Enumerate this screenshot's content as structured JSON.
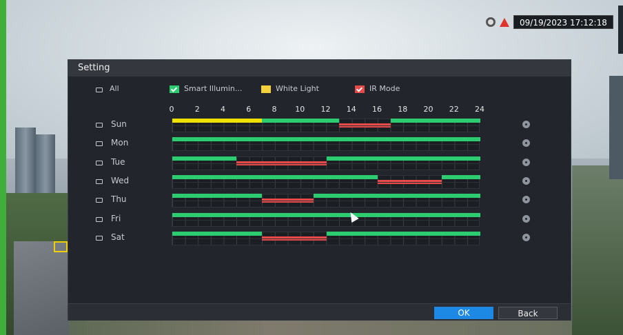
{
  "status": {
    "datetime": "09/19/2023 17:12:18"
  },
  "dialog": {
    "title": "Setting",
    "all_label": "All",
    "legend": [
      {
        "label": "Smart Illumin...",
        "color": "#2ecc71",
        "checked": true
      },
      {
        "label": "White Light",
        "color": "#f5d23a",
        "checked": false
      },
      {
        "label": "IR Mode",
        "color": "#e84a4a",
        "checked": true
      }
    ],
    "hours": [
      "0",
      "2",
      "4",
      "6",
      "8",
      "10",
      "12",
      "14",
      "16",
      "18",
      "20",
      "22",
      "24"
    ],
    "days": [
      {
        "label": "Sun",
        "bars": [
          {
            "row": 0,
            "start": 0,
            "end": 7,
            "color": "#f0e000"
          },
          {
            "row": 0,
            "start": 7,
            "end": 13,
            "color": "#2ecc71"
          },
          {
            "row": 0,
            "start": 17,
            "end": 24,
            "color": "#2ecc71"
          },
          {
            "row": 1,
            "start": 13,
            "end": 17,
            "color": "#e84a4a"
          }
        ]
      },
      {
        "label": "Mon",
        "bars": [
          {
            "row": 0,
            "start": 0,
            "end": 24,
            "color": "#2ecc71"
          }
        ]
      },
      {
        "label": "Tue",
        "bars": [
          {
            "row": 0,
            "start": 0,
            "end": 5,
            "color": "#2ecc71"
          },
          {
            "row": 0,
            "start": 12,
            "end": 24,
            "color": "#2ecc71"
          },
          {
            "row": 1,
            "start": 5,
            "end": 12,
            "color": "#e84a4a"
          }
        ]
      },
      {
        "label": "Wed",
        "bars": [
          {
            "row": 0,
            "start": 0,
            "end": 16,
            "color": "#2ecc71"
          },
          {
            "row": 0,
            "start": 21,
            "end": 24,
            "color": "#2ecc71"
          },
          {
            "row": 1,
            "start": 16,
            "end": 21,
            "color": "#e84a4a"
          }
        ]
      },
      {
        "label": "Thu",
        "bars": [
          {
            "row": 0,
            "start": 0,
            "end": 7,
            "color": "#2ecc71"
          },
          {
            "row": 0,
            "start": 11,
            "end": 24,
            "color": "#2ecc71"
          },
          {
            "row": 1,
            "start": 7,
            "end": 11,
            "color": "#e84a4a"
          }
        ]
      },
      {
        "label": "Fri",
        "bars": [
          {
            "row": 0,
            "start": 0,
            "end": 24,
            "color": "#2ecc71"
          }
        ]
      },
      {
        "label": "Sat",
        "bars": [
          {
            "row": 0,
            "start": 0,
            "end": 7,
            "color": "#2ecc71"
          },
          {
            "row": 0,
            "start": 12,
            "end": 24,
            "color": "#2ecc71"
          },
          {
            "row": 1,
            "start": 7,
            "end": 12,
            "color": "#e84a4a"
          }
        ]
      }
    ],
    "ok_label": "OK",
    "back_label": "Back"
  }
}
